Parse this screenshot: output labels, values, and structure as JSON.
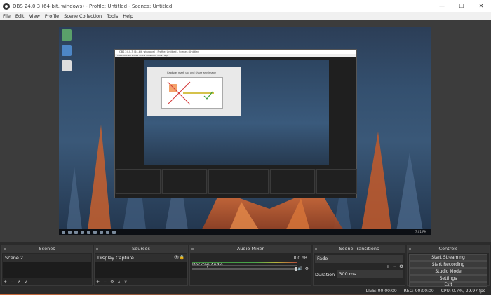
{
  "window": {
    "title": "OBS 24.0.3 (64-bit, windows) - Profile: Untitled - Scenes: Untitled",
    "minimize": "—",
    "maximize": "☐",
    "close": "✕"
  },
  "menu": [
    "File",
    "Edit",
    "View",
    "Profile",
    "Scene Collection",
    "Tools",
    "Help"
  ],
  "preview": {
    "inner_title": "OBS 24.0.3 (64-bit, windows) - Profile: Untitled - Scenes: Untitled",
    "inner_menu": "File  Edit  View  Profile  Scene Collection  Tools  Help",
    "dialog_text": "Capture, mark up, and share any image",
    "clock": "7:01 PM"
  },
  "docks": {
    "scenes": {
      "title": "Scenes",
      "items": [
        "Scene 2"
      ]
    },
    "sources": {
      "title": "Sources",
      "items": [
        "Display Capture"
      ]
    },
    "mixer": {
      "title": "Audio Mixer",
      "track_label": "Desktop Audio",
      "db": "0.0 dB"
    },
    "transitions": {
      "title": "Scene Transitions",
      "transition": "Fade",
      "duration_label": "Duration",
      "duration_value": "300 ms"
    },
    "controls": {
      "title": "Controls",
      "start_streaming": "Start Streaming",
      "start_recording": "Start Recording",
      "studio_mode": "Studio Mode",
      "settings": "Settings",
      "exit": "Exit"
    }
  },
  "toolbar": {
    "add": "+",
    "remove": "−",
    "settings": "⚙",
    "up": "∧",
    "down": "∨"
  },
  "status": {
    "live": "LIVE: 00:00:00",
    "rec": "REC: 00:00:00",
    "cpu": "CPU: 0.7%, 29.97 fps"
  },
  "colors": {
    "panel": "#272727",
    "title_bar": "#383838",
    "meter_green": "#4aa64a",
    "meter_red": "#b84a3a"
  }
}
